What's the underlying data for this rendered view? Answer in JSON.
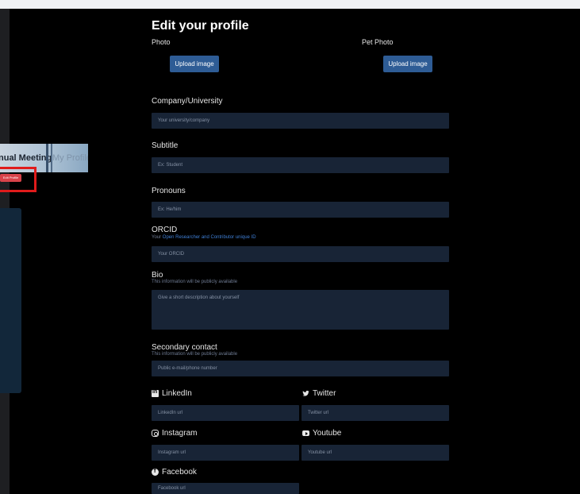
{
  "background_page": {
    "meeting_text": "nual Meeting",
    "profile_tab": "My Profile",
    "edit_profile_button": "Edit Profile"
  },
  "modal": {
    "title": "Edit your profile",
    "photo": {
      "label": "Photo",
      "button": "Upload image"
    },
    "pet_photo": {
      "label": "Pet Photo",
      "button": "Upload image"
    },
    "company": {
      "label": "Company/University",
      "placeholder": "Your university/company"
    },
    "subtitle": {
      "label": "Subtitle",
      "placeholder": "Ex: Student"
    },
    "pronouns": {
      "label": "Pronouns",
      "placeholder": "Ex: He/him"
    },
    "orcid": {
      "label": "ORCID",
      "sub_prefix": "Your ",
      "sub_link": "Open Researcher and Contributor unique ID",
      "placeholder": "Your ORCID"
    },
    "bio": {
      "label": "Bio",
      "sub": "This information will be publicly available",
      "placeholder": "Give a short description about yourself"
    },
    "secondary_contact": {
      "label": "Secondary contact",
      "sub": "This information will be publicly available",
      "placeholder": "Public e-mail/phone number"
    },
    "socials": {
      "linkedin": {
        "label": "LinkedIn",
        "placeholder": "LinkedIn url"
      },
      "twitter": {
        "label": "Twitter",
        "placeholder": "Twitter url"
      },
      "instagram": {
        "label": "Instagram",
        "placeholder": "Instagram url"
      },
      "youtube": {
        "label": "Youtube",
        "placeholder": "Youtube url"
      },
      "facebook": {
        "label": "Facebook",
        "placeholder": "Facebook url"
      }
    }
  },
  "colors": {
    "primary_button": "#2e5c95",
    "input_bg": "#182436",
    "highlight_box": "#e01b1b",
    "link": "#3f7fd6"
  }
}
